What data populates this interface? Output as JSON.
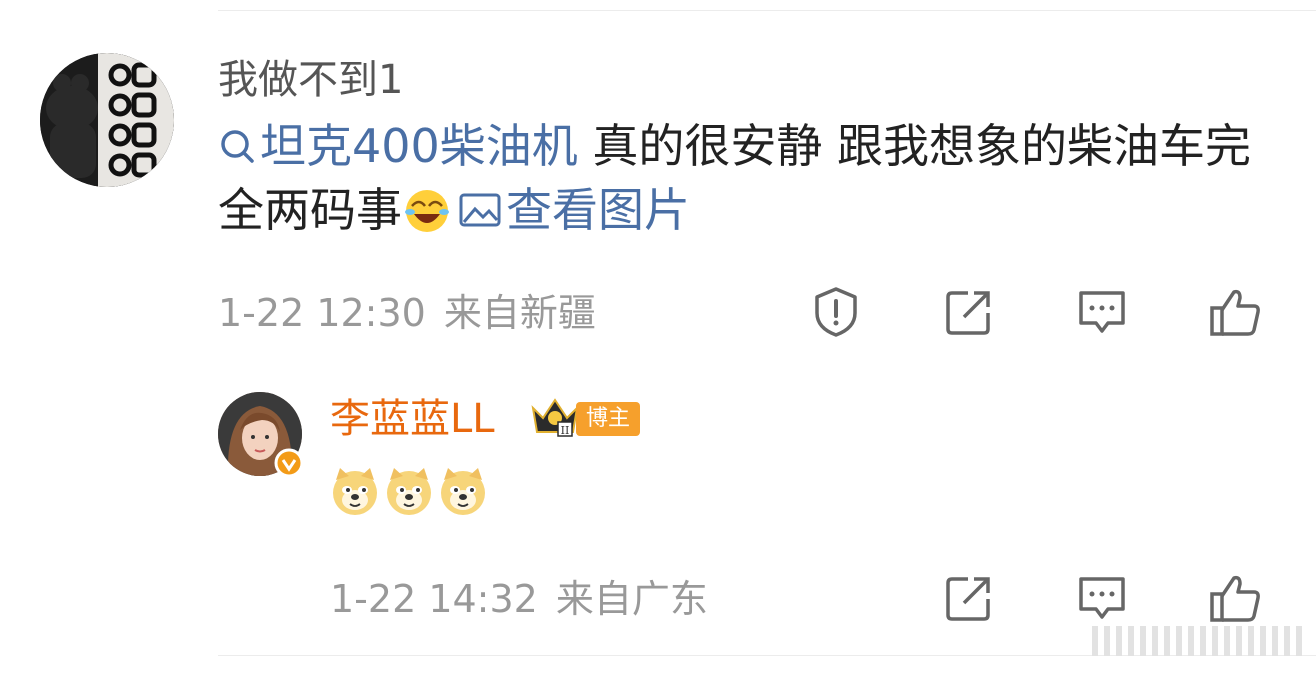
{
  "comment": {
    "username": "我做不到1",
    "topic_link": "坦克400柴油机",
    "text": " 真的很安静 跟我想象的柴油车完全两码事",
    "view_image_link": "查看图片",
    "time": "1-22 12:30",
    "location": "来自新疆"
  },
  "reply": {
    "username": "李蓝蓝LL",
    "badge": "博主",
    "emoji_count": 3,
    "time": "1-22 14:32",
    "location": "来自广东"
  },
  "colors": {
    "link": "#4a6fa5",
    "reply_name": "#e8680e",
    "badge_bg": "#f6a02c",
    "meta": "#999999",
    "icon": "#666666"
  },
  "icons": [
    "search-icon",
    "image-icon",
    "laughing-emoji",
    "report-icon",
    "repost-icon",
    "comment-icon",
    "like-icon",
    "doge-emoji",
    "crown-icon",
    "verified-icon"
  ]
}
